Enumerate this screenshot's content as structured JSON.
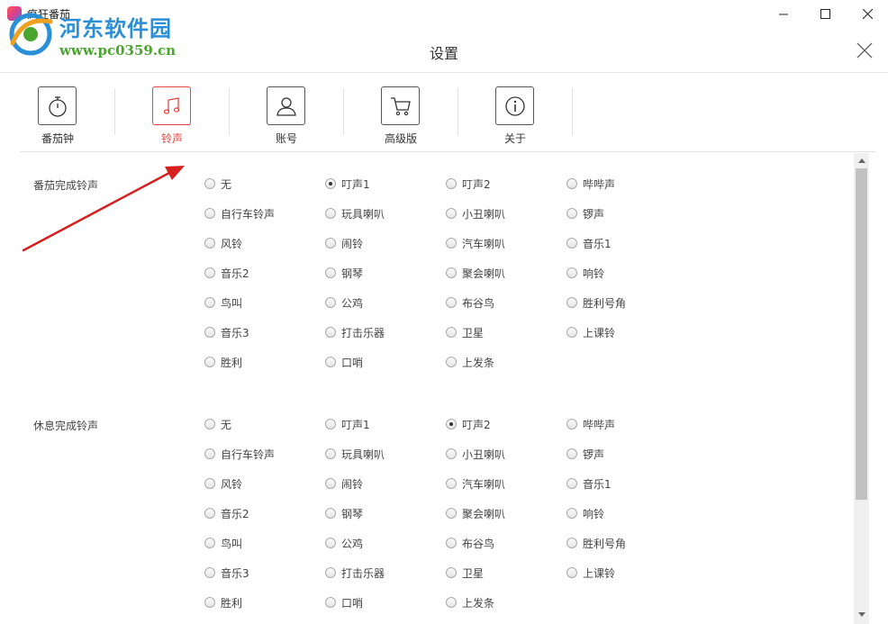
{
  "window": {
    "title": "疯狂番茄",
    "minimize_icon": "minimize-icon",
    "maximize_icon": "maximize-icon",
    "close_icon": "close-icon"
  },
  "watermark": {
    "title": "河东软件园",
    "url": "www.pc0359.cn"
  },
  "dialog": {
    "title": "设置",
    "close_icon": "close-x-icon"
  },
  "tabs": [
    {
      "label": "番茄钟",
      "icon": "timer-icon",
      "active": false
    },
    {
      "label": "铃声",
      "icon": "music-note-icon",
      "active": true
    },
    {
      "label": "账号",
      "icon": "user-icon",
      "active": false
    },
    {
      "label": "高级版",
      "icon": "cart-icon",
      "active": false
    },
    {
      "label": "关于",
      "icon": "info-icon",
      "active": false
    }
  ],
  "accent_color": "#e8463e",
  "sections": [
    {
      "label": "番茄完成铃声",
      "selected": "叮声1",
      "options": [
        "无",
        "叮声1",
        "叮声2",
        "哔哔声",
        "自行车铃声",
        "玩具喇叭",
        "小丑喇叭",
        "锣声",
        "风铃",
        "闹铃",
        "汽车喇叭",
        "音乐1",
        "音乐2",
        "钢琴",
        "聚会喇叭",
        "响铃",
        "鸟叫",
        "公鸡",
        "布谷鸟",
        "胜利号角",
        "音乐3",
        "打击乐器",
        "卫星",
        "上课铃",
        "胜利",
        "口哨",
        "上发条"
      ]
    },
    {
      "label": "休息完成铃声",
      "selected": "叮声2",
      "options": [
        "无",
        "叮声1",
        "叮声2",
        "哔哔声",
        "自行车铃声",
        "玩具喇叭",
        "小丑喇叭",
        "锣声",
        "风铃",
        "闹铃",
        "汽车喇叭",
        "音乐1",
        "音乐2",
        "钢琴",
        "聚会喇叭",
        "响铃",
        "鸟叫",
        "公鸡",
        "布谷鸟",
        "胜利号角",
        "音乐3",
        "打击乐器",
        "卫星",
        "上课铃",
        "胜利",
        "口哨",
        "上发条"
      ]
    }
  ]
}
